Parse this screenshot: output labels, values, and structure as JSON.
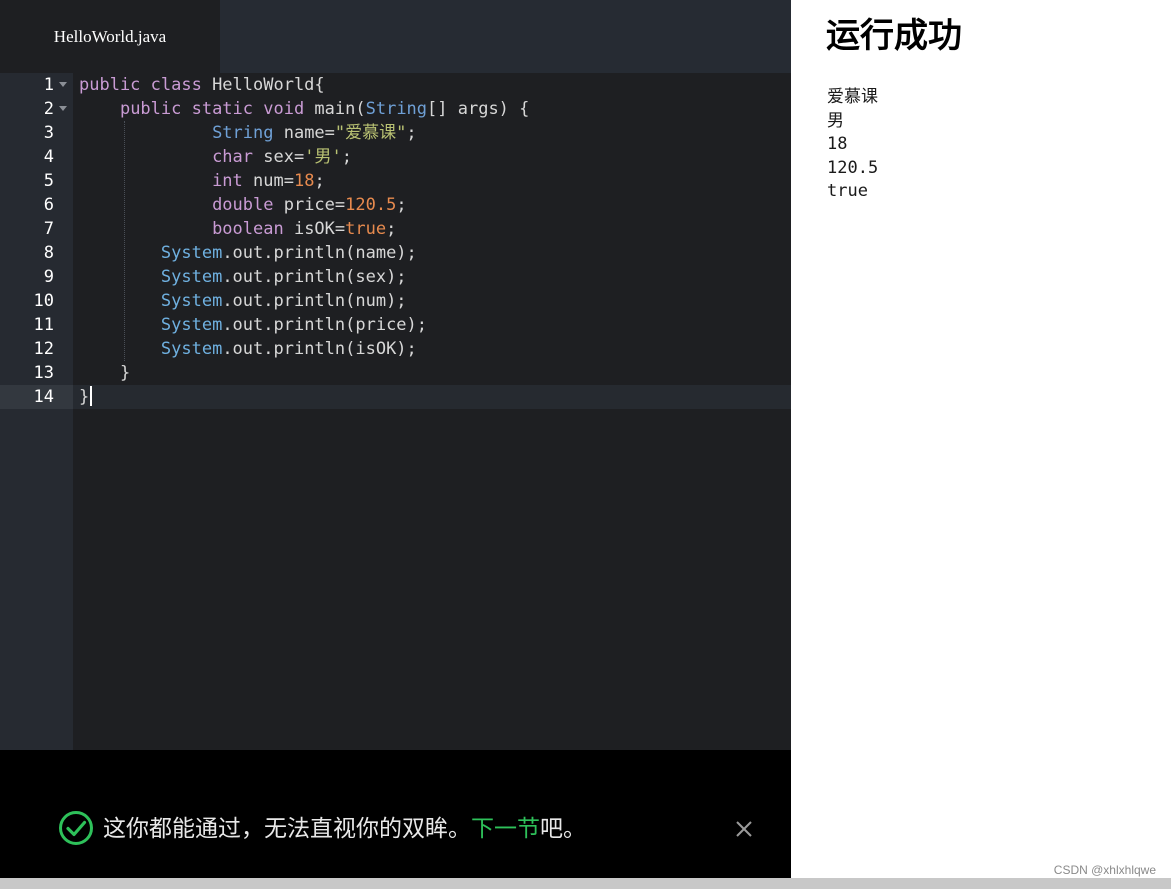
{
  "editor": {
    "tab_label": "HelloWorld.java",
    "line_numbers": [
      "1",
      "2",
      "3",
      "4",
      "5",
      "6",
      "7",
      "8",
      "9",
      "10",
      "11",
      "12",
      "13",
      "14"
    ],
    "code": {
      "l1_kw": "public class ",
      "l1_name": "HelloWorld{",
      "l2_kw": "public static void ",
      "l2_main": "main(",
      "l2_type": "String",
      "l2_rest": "[] args) {",
      "l3_type": "String",
      "l3_a": " name=",
      "l3_str": "\"爱慕课\"",
      "l3_end": ";",
      "l4_kw": "char",
      "l4_a": " sex=",
      "l4_str": "'男'",
      "l4_end": ";",
      "l5_kw": "int",
      "l5_a": " num=",
      "l5_num": "18",
      "l5_end": ";",
      "l6_kw": "double",
      "l6_a": " price=",
      "l6_num": "120.5",
      "l6_end": ";",
      "l7_kw": "boolean",
      "l7_a": " isOK=",
      "l7_bool": "true",
      "l7_end": ";",
      "l8_sys": "System",
      "l8_rest": ".out.println(name);",
      "l9_sys": "System",
      "l9_rest": ".out.println(sex);",
      "l10_sys": "System",
      "l10_rest": ".out.println(num);",
      "l11_sys": "System",
      "l11_rest": ".out.println(price);",
      "l12_sys": "System",
      "l12_rest": ".out.println(isOK);",
      "l13": "}",
      "l14": "}"
    }
  },
  "notice": {
    "text_before": "这你都能通过，无法直视你的双眸。",
    "link": "下一节",
    "text_after": "吧。",
    "accent_color": "#2ec15a",
    "icon": "check-circle-icon"
  },
  "output": {
    "title": "运行成功",
    "lines": [
      "爱慕课",
      "男",
      "18",
      "120.5",
      "true"
    ]
  },
  "watermark": "CSDN @xhlxhlqwe"
}
